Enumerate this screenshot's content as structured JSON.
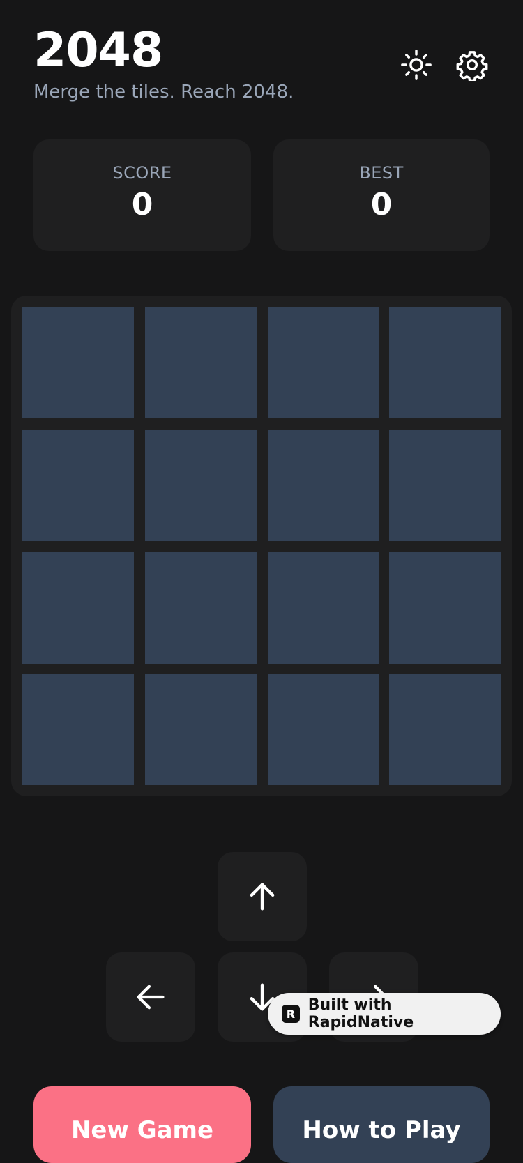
{
  "header": {
    "title": "2048",
    "subtitle": "Merge the tiles. Reach 2048.",
    "theme_icon": "sun-icon",
    "settings_icon": "gear-icon"
  },
  "scores": {
    "score_label": "SCORE",
    "score_value": "0",
    "best_label": "BEST",
    "best_value": "0"
  },
  "board": {
    "rows": 4,
    "cols": 4,
    "tiles": [
      "",
      "",
      "",
      "",
      "",
      "",
      "",
      "",
      "",
      "",
      "",
      "",
      "",
      "",
      "",
      ""
    ],
    "empty_tile_color": "#334155"
  },
  "controls": {
    "up_icon": "arrow-up-icon",
    "left_icon": "arrow-left-icon",
    "down_icon": "arrow-down-icon",
    "right_icon": "arrow-right-icon"
  },
  "badge": {
    "text": "Built with RapidNative",
    "logo": "R"
  },
  "actions": {
    "new_game_label": "New Game",
    "new_game_color": "#fb7185",
    "how_to_play_label": "How to Play",
    "how_to_play_color": "#334155"
  }
}
